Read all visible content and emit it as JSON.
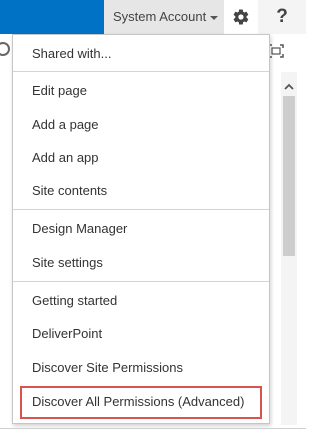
{
  "suite_bar": {
    "account_label": "System Account",
    "help_label": "?"
  },
  "menu": {
    "items": [
      {
        "label": "Shared with..."
      },
      {
        "label": "Edit page"
      },
      {
        "label": "Add a page"
      },
      {
        "label": "Add an app"
      },
      {
        "label": "Site contents"
      },
      {
        "label": "Design Manager"
      },
      {
        "label": "Site settings"
      },
      {
        "label": "Getting started"
      },
      {
        "label": "DeliverPoint"
      },
      {
        "label": "Discover Site Permissions"
      },
      {
        "label": "Discover All Permissions (Advanced)"
      }
    ]
  },
  "icons": {
    "settings": "gear-icon",
    "help": "help-icon",
    "account_caret": "chevron-down-icon",
    "focus": "focus-on-content-icon",
    "sync": "sync-icon",
    "scroll_up": "chevron-up-icon"
  },
  "colors": {
    "suite_bar": "#0072c6",
    "highlight": "#d9534f"
  }
}
